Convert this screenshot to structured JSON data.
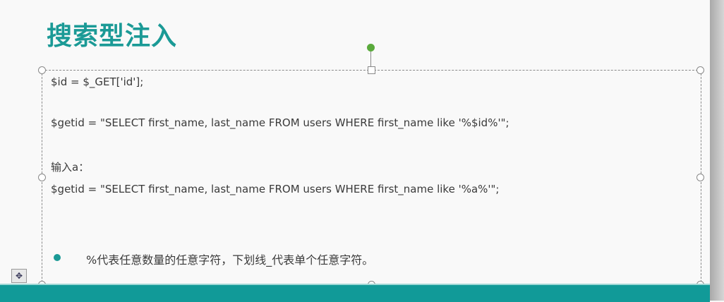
{
  "slide": {
    "title": "搜索型注入",
    "lines": [
      "$id = $_GET['id'];",
      "$getid = \"SELECT first_name, last_name FROM users WHERE first_name like '%$id%'\";",
      "输入a：",
      "$getid = \"SELECT first_name, last_name FROM users WHERE first_name like '%a%'\";"
    ],
    "bullet": "%代表任意数量的任意字符，下划线_代表单个任意字符。"
  },
  "colors": {
    "accent": "#1b9a96",
    "footer": "#119a98"
  },
  "icons": {
    "move": "move-icon",
    "rotate": "rotate-handle-icon"
  }
}
